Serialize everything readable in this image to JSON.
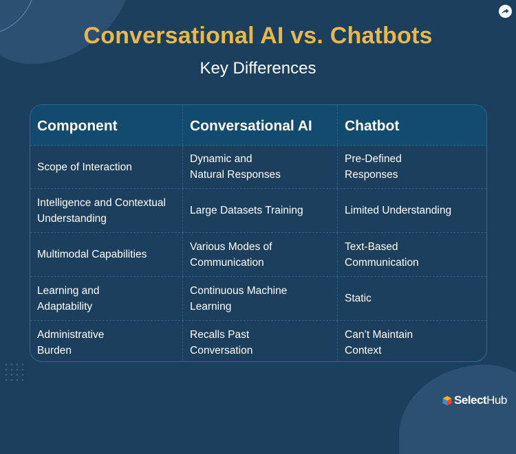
{
  "header": {
    "title": "Conversational AI vs. Chatbots",
    "subtitle": "Key Differences"
  },
  "share": {
    "icon": "share-arrow-icon"
  },
  "table": {
    "columns": [
      "Component",
      "Conversational AI",
      "Chatbot"
    ],
    "rows": [
      [
        "Scope of Interaction",
        "Dynamic and\nNatural Responses",
        "Pre-Defined\nResponses"
      ],
      [
        "Intelligence and Contextual\nUnderstanding",
        "Large Datasets Training",
        "Limited Understanding"
      ],
      [
        "Multimodal Capabilities",
        "Various Modes of\nCommunication",
        "Text-Based\nCommunication"
      ],
      [
        "Learning and\nAdaptability",
        "Continuous Machine\nLearning",
        "Static"
      ],
      [
        "Administrative\nBurden",
        "Recalls Past\nConversation",
        "Can’t Maintain\nContext"
      ]
    ]
  },
  "brand": {
    "name_bold": "Select",
    "name_regular": "Hub",
    "icon": "selecthub-cube-icon",
    "colors": {
      "title": "#e8b84a",
      "background": "#1c3f5e",
      "header": "#134b6e"
    }
  }
}
